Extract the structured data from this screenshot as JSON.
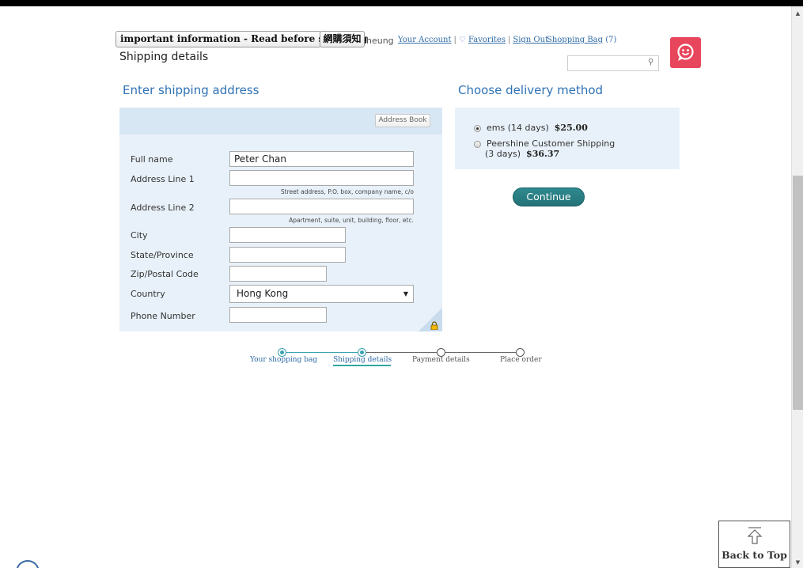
{
  "header": {
    "info_box": "important information - Read before shopping",
    "notice_box": "網購須知",
    "user_name": "heung",
    "your_account": "Your Account",
    "favorites": "Favorites",
    "sign_out": "Sign Out",
    "shopping_bag_label": "Shopping Bag",
    "shopping_bag_count": "(7)",
    "search_placeholder": "",
    "brand_color": "#e8465c"
  },
  "page_title": "Shipping details",
  "shipping": {
    "heading": "Enter shipping address",
    "address_book_label": "Address Book",
    "fields": {
      "full_name": {
        "label": "Full name",
        "value": "Peter Chan"
      },
      "address1": {
        "label": "Address Line 1",
        "value": "",
        "hint": "Street address, P.O. box, company name, c/o"
      },
      "address2": {
        "label": "Address Line 2",
        "value": "",
        "hint": "Apartment, suite, unit, building, floor, etc."
      },
      "city": {
        "label": "City",
        "value": ""
      },
      "state": {
        "label": "State/Province",
        "value": ""
      },
      "zip": {
        "label": "Zip/Postal Code",
        "value": ""
      },
      "country": {
        "label": "Country",
        "value": "Hong Kong"
      },
      "phone": {
        "label": "Phone Number",
        "value": ""
      }
    }
  },
  "delivery": {
    "heading": "Choose delivery method",
    "options": [
      {
        "label": "ems (14 days)",
        "price": "$25.00",
        "selected": true
      },
      {
        "label_line1": "Peershine Customer Shipping",
        "label_line2": "(3 days)",
        "price": "$36.37",
        "selected": false
      }
    ],
    "continue_label": "Continue"
  },
  "progress": {
    "steps": [
      {
        "label": "Your shopping bag",
        "state": "done"
      },
      {
        "label": "Shipping details",
        "state": "current"
      },
      {
        "label": "Payment details",
        "state": "todo"
      },
      {
        "label": "Place order",
        "state": "todo"
      }
    ],
    "accent_color": "#3aa2b0"
  },
  "back_to_top": "Back to Top",
  "icons": {
    "search": "search-icon",
    "heart": "heart-icon",
    "lock": "lock-icon",
    "dropdown": "chevron-down-icon",
    "back_to_top": "arrow-up-icon"
  }
}
